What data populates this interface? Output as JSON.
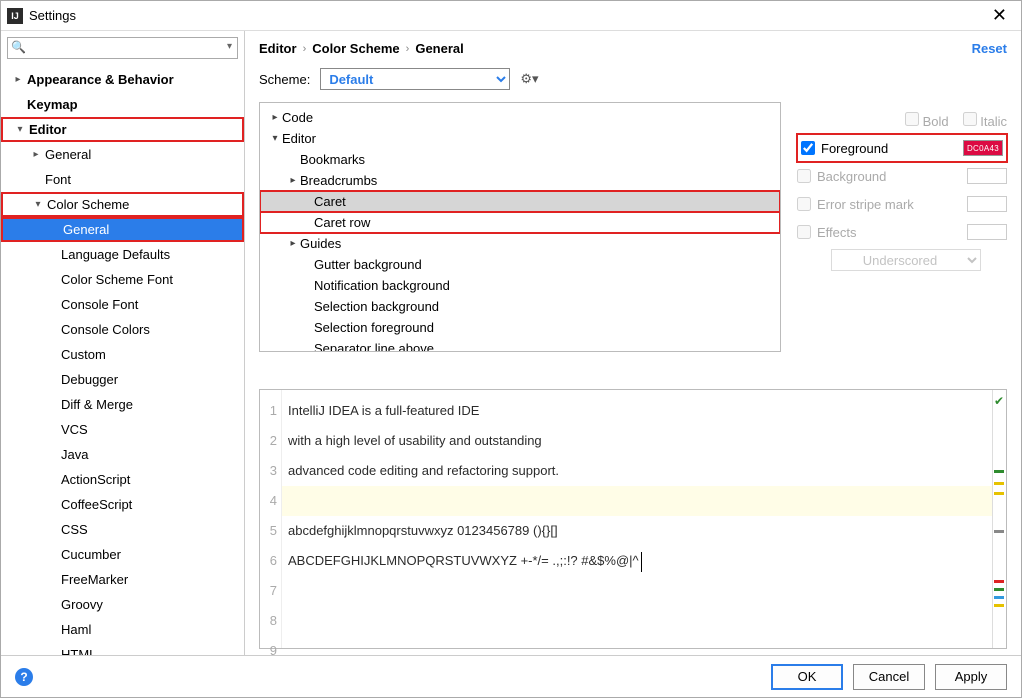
{
  "window": {
    "title": "Settings"
  },
  "search": {
    "placeholder": ""
  },
  "sidebar": {
    "items": [
      {
        "label": "Appearance & Behavior",
        "bold": true,
        "pad": 0,
        "exp": "r"
      },
      {
        "label": "Keymap",
        "bold": true,
        "pad": 0
      },
      {
        "label": "Editor",
        "bold": true,
        "pad": 0,
        "exp": "d",
        "hi": true
      },
      {
        "label": "General",
        "pad": 1,
        "exp": "r"
      },
      {
        "label": "Font",
        "pad": 1
      },
      {
        "label": "Color Scheme",
        "pad": 1,
        "exp": "d",
        "hi": true
      },
      {
        "label": "General",
        "pad": 2,
        "selected": true,
        "hi": true
      },
      {
        "label": "Language Defaults",
        "pad": 2
      },
      {
        "label": "Color Scheme Font",
        "pad": 2
      },
      {
        "label": "Console Font",
        "pad": 2
      },
      {
        "label": "Console Colors",
        "pad": 2
      },
      {
        "label": "Custom",
        "pad": 2
      },
      {
        "label": "Debugger",
        "pad": 2
      },
      {
        "label": "Diff & Merge",
        "pad": 2
      },
      {
        "label": "VCS",
        "pad": 2
      },
      {
        "label": "Java",
        "pad": 2
      },
      {
        "label": "ActionScript",
        "pad": 2
      },
      {
        "label": "CoffeeScript",
        "pad": 2
      },
      {
        "label": "CSS",
        "pad": 2
      },
      {
        "label": "Cucumber",
        "pad": 2
      },
      {
        "label": "FreeMarker",
        "pad": 2
      },
      {
        "label": "Groovy",
        "pad": 2
      },
      {
        "label": "Haml",
        "pad": 2
      },
      {
        "label": "HTML",
        "pad": 2
      }
    ]
  },
  "breadcrumb": {
    "a": "Editor",
    "b": "Color Scheme",
    "c": "General",
    "reset": "Reset"
  },
  "scheme": {
    "label": "Scheme:",
    "value": "Default"
  },
  "categories": [
    {
      "label": "Code",
      "pad": 0,
      "exp": "r"
    },
    {
      "label": "Editor",
      "pad": 0,
      "exp": "d"
    },
    {
      "label": "Bookmarks",
      "pad": 1
    },
    {
      "label": "Breadcrumbs",
      "pad": 1,
      "exp": "r"
    },
    {
      "label": "Caret",
      "pad": 2,
      "selected": true,
      "hi": true
    },
    {
      "label": "Caret row",
      "pad": 2,
      "hi": true
    },
    {
      "label": "Guides",
      "pad": 1,
      "exp": "r"
    },
    {
      "label": "Gutter background",
      "pad": 2
    },
    {
      "label": "Notification background",
      "pad": 2
    },
    {
      "label": "Selection background",
      "pad": 2
    },
    {
      "label": "Selection foreground",
      "pad": 2
    },
    {
      "label": "Separator line above",
      "pad": 2
    }
  ],
  "props": {
    "bold": "Bold",
    "italic": "Italic",
    "foreground": "Foreground",
    "fg_value": "DC0A43",
    "background": "Background",
    "error_stripe": "Error stripe mark",
    "effects": "Effects",
    "effects_type": "Underscored"
  },
  "preview": {
    "lines": [
      "IntelliJ IDEA is a full-featured IDE",
      "with a high level of usability and outstanding",
      "advanced code editing and refactoring support.",
      "",
      "abcdefghijklmnopqrstuvwxyz 0123456789 (){}[]",
      "ABCDEFGHIJKLMNOPQRSTUVWXYZ +-*/= .,;:!? #&$%@|^",
      "",
      "",
      ""
    ]
  },
  "footer": {
    "ok": "OK",
    "cancel": "Cancel",
    "apply": "Apply"
  }
}
